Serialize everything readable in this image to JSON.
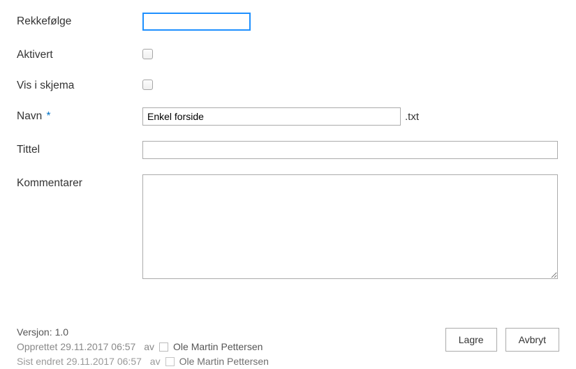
{
  "form": {
    "order_label": "Rekkefølge",
    "order_value": "",
    "enabled_label": "Aktivert",
    "show_in_form_label": "Vis i skjema",
    "name_label": "Navn",
    "name_required_marker": "*",
    "name_value": "Enkel forside",
    "name_suffix": ".txt",
    "title_label": "Tittel",
    "title_value": "",
    "comments_label": "Kommentarer",
    "comments_value": ""
  },
  "meta": {
    "version_label": "Versjon:",
    "version_value": "1.0",
    "created_label": "Opprettet",
    "created_datetime": "29.11.2017 06:57",
    "by_label": "av",
    "created_user": "Ole Martin Pettersen",
    "modified_label": "Sist endret",
    "modified_datetime": "29.11.2017 06:57",
    "modified_user": "Ole Martin Pettersen"
  },
  "buttons": {
    "save": "Lagre",
    "cancel": "Avbryt"
  }
}
